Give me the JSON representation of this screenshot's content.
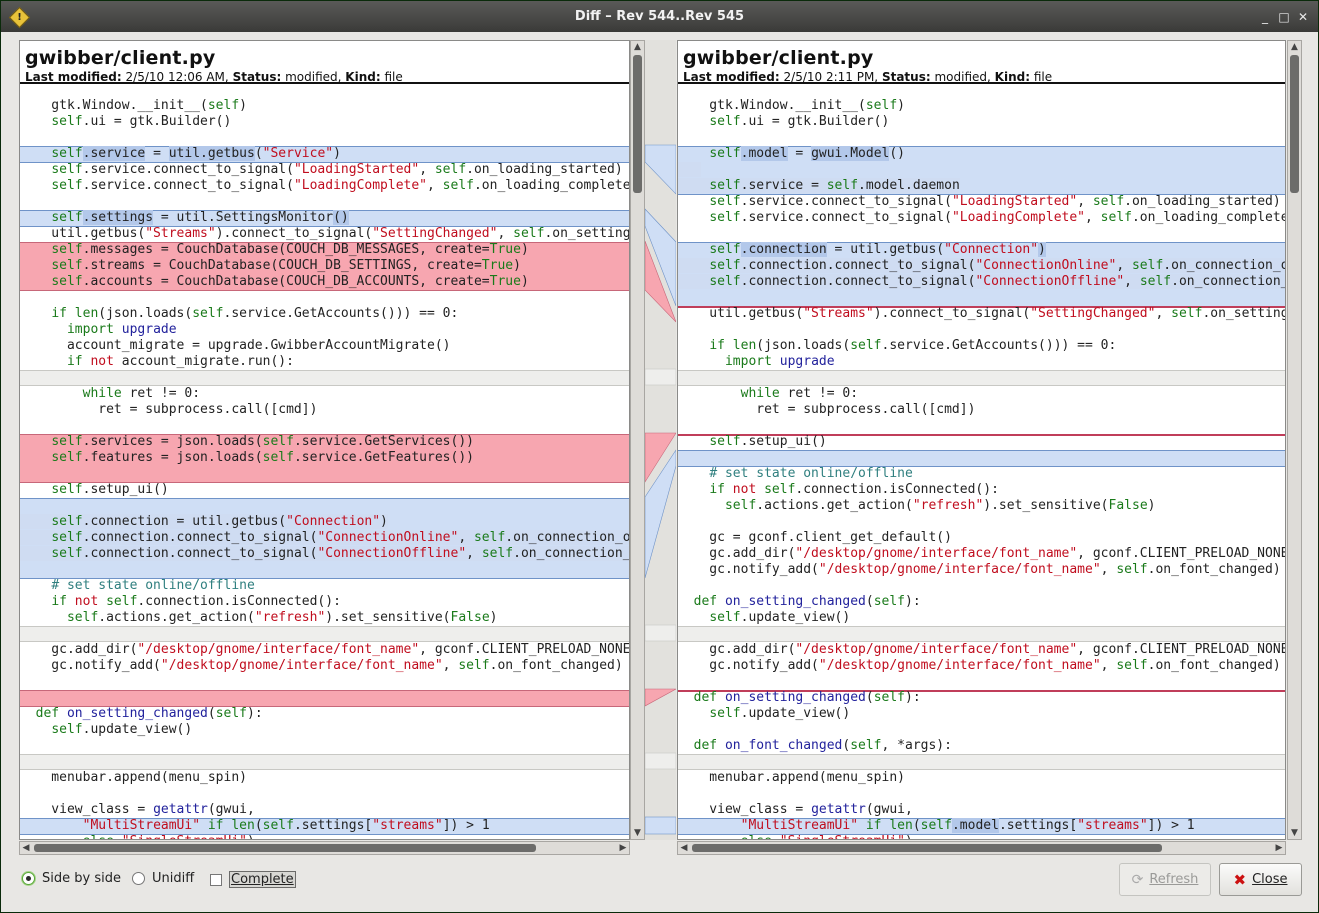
{
  "window": {
    "title": "Diff – Rev 544..Rev 545",
    "app_icon": "warning-diamond-icon"
  },
  "left": {
    "filename": "gwibber/client.py",
    "meta_label_modified": "Last modified:",
    "modified": "2/5/10 12:06 AM,",
    "meta_label_status": "Status:",
    "status": "modified,",
    "meta_label_kind": "Kind:",
    "kind": "file"
  },
  "right": {
    "filename": "gwibber/client.py",
    "meta_label_modified": "Last modified:",
    "modified": "2/5/10 2:11 PM,",
    "meta_label_status": "Status:",
    "status": "modified,",
    "meta_label_kind": "Kind:",
    "kind": "file"
  },
  "options": {
    "side_by_side": "Side by side",
    "unidiff": "Unidiff",
    "complete": "Complete"
  },
  "buttons": {
    "refresh": "Refresh",
    "close": "Close"
  },
  "colors": {
    "added": "#cfdef5",
    "deleted": "#f7a6b0",
    "separator": "#eeeeec",
    "string": "#c00d1e",
    "keyword": "#1a7a1a"
  }
}
